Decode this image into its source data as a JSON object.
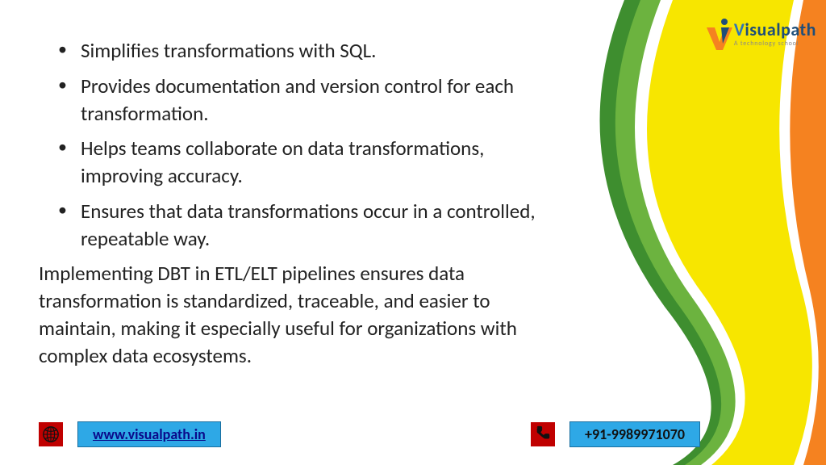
{
  "logo": {
    "name_a": "V",
    "name_b": "isualpath",
    "tagline": "A technology school"
  },
  "bullets": [
    "Simplifies transformations with SQL.",
    "Provides documentation and version control for each transformation.",
    "Helps teams collaborate on data transformations, improving accuracy.",
    "Ensures that data transformations occur in a controlled, repeatable way."
  ],
  "paragraph": "Implementing DBT in ETL/ELT pipelines ensures data transformation is standardized, traceable, and easier to maintain, making it especially useful for organizations with complex data ecosystems.",
  "footer": {
    "url": "www.visualpath.in",
    "phone": "+91-9989971070",
    "web_icon": "globe-icon",
    "phone_icon": "phone-icon"
  }
}
